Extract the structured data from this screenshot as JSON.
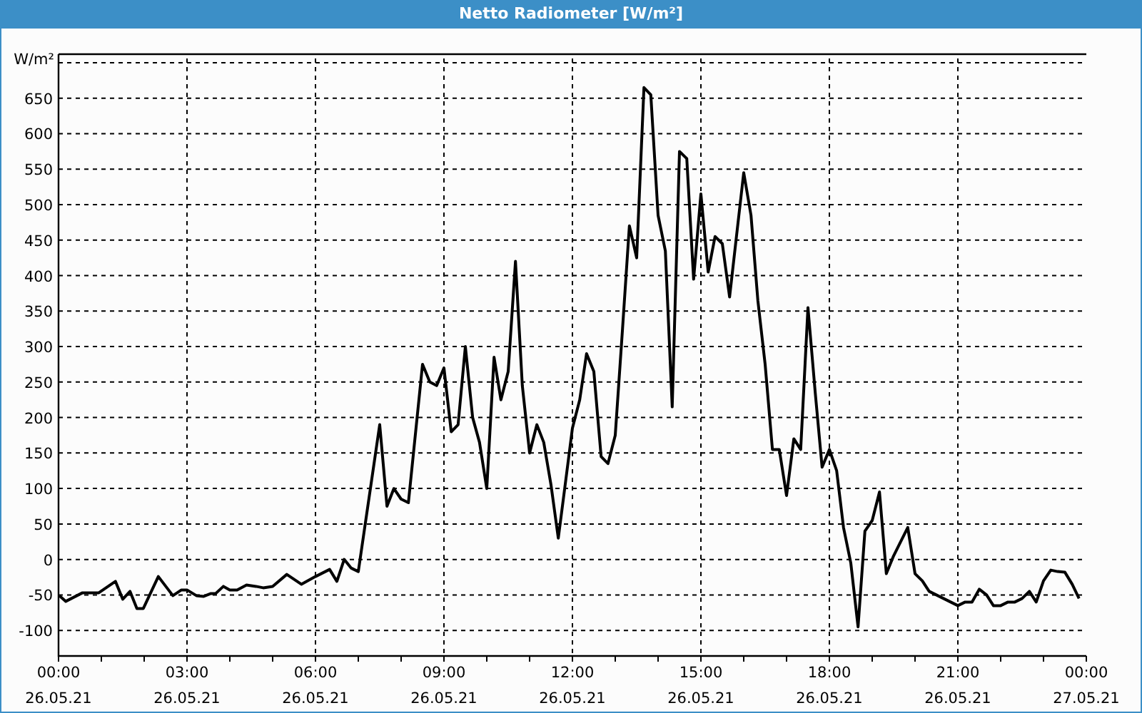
{
  "window": {
    "title": "Netto Radiometer [W/m²]"
  },
  "chart_data": {
    "type": "line",
    "ylabel": "W/m²",
    "xlim": [
      0,
      24
    ],
    "ylim": [
      -136,
      706
    ],
    "x": [
      0.02,
      0.17,
      0.56,
      0.94,
      1.28,
      1.33,
      1.5,
      1.67,
      1.83,
      1.98,
      2.33,
      2.67,
      2.87,
      3.0,
      3.22,
      3.39,
      3.56,
      3.67,
      3.85,
      4.0,
      4.17,
      4.39,
      4.61,
      4.78,
      5.0,
      5.33,
      5.67,
      6.0,
      6.33,
      6.5,
      6.67,
      6.83,
      7.0,
      7.5,
      7.67,
      7.83,
      8.0,
      8.17,
      8.5,
      8.67,
      8.83,
      9.0,
      9.17,
      9.33,
      9.5,
      9.67,
      9.83,
      10.0,
      10.17,
      10.33,
      10.5,
      10.67,
      10.83,
      11.0,
      11.17,
      11.33,
      11.5,
      11.67,
      11.83,
      12.0,
      12.17,
      12.33,
      12.5,
      12.67,
      12.83,
      13.0,
      13.17,
      13.33,
      13.5,
      13.67,
      13.83,
      14.0,
      14.17,
      14.33,
      14.5,
      14.67,
      14.83,
      15.0,
      15.17,
      15.33,
      15.5,
      15.67,
      15.83,
      16.0,
      16.17,
      16.33,
      16.5,
      16.67,
      16.83,
      17.0,
      17.17,
      17.33,
      17.5,
      17.67,
      17.83,
      18.0,
      18.17,
      18.33,
      18.5,
      18.67,
      18.83,
      19.0,
      19.17,
      19.33,
      19.5,
      19.83,
      20.0,
      20.17,
      20.33,
      21.0,
      21.17,
      21.33,
      21.5,
      21.67,
      21.83,
      22.0,
      22.17,
      22.33,
      22.5,
      22.67,
      22.83,
      23.0,
      23.17,
      23.33,
      23.5,
      23.67,
      23.83
    ],
    "series": [
      {
        "color": "#000000",
        "values": [
          -51,
          -59,
          -47,
          -47,
          -33,
          -31,
          -56,
          -45,
          -69,
          -69,
          -24,
          -51,
          -43,
          -43,
          -51,
          -52,
          -48,
          -48,
          -38,
          -43,
          -43,
          -36,
          -38,
          -40,
          -38,
          -21,
          -35,
          -24,
          -14,
          -31,
          0,
          -12,
          -17,
          190,
          75,
          100,
          85,
          80,
          275,
          250,
          245,
          270,
          180,
          190,
          300,
          200,
          165,
          100,
          285,
          225,
          265,
          420,
          245,
          150,
          190,
          165,
          105,
          30,
          105,
          185,
          225,
          290,
          265,
          145,
          135,
          175,
          325,
          470,
          425,
          665,
          655,
          485,
          435,
          215,
          575,
          565,
          395,
          515,
          405,
          455,
          445,
          370,
          455,
          545,
          485,
          365,
          275,
          155,
          155,
          90,
          170,
          155,
          355,
          235,
          130,
          155,
          125,
          45,
          -5,
          -95,
          40,
          55,
          95,
          -20,
          5,
          45,
          -20,
          -30,
          -45,
          -65,
          -60,
          -60,
          -42,
          -50,
          -65,
          -65,
          -60,
          -60,
          -55,
          -45,
          -60,
          -30,
          -15,
          -17,
          -18,
          -35,
          -55
        ]
      }
    ],
    "xticks": [
      {
        "value": 0,
        "label": "00:00"
      },
      {
        "value": 3,
        "label": "03:00"
      },
      {
        "value": 6,
        "label": "06:00"
      },
      {
        "value": 9,
        "label": "09:00"
      },
      {
        "value": 12,
        "label": "12:00"
      },
      {
        "value": 15,
        "label": "15:00"
      },
      {
        "value": 18,
        "label": "18:00"
      },
      {
        "value": 21,
        "label": "21:00"
      },
      {
        "value": 24,
        "label": "00:00"
      }
    ],
    "annotations": [
      "26.05.21",
      "26.05.21",
      "26.05.21",
      "26.05.21",
      "26.05.21",
      "26.05.21",
      "26.05.21",
      "26.05.21",
      "27.05.21"
    ],
    "grid": true,
    "yticks": [
      -100,
      -50,
      0,
      50,
      100,
      150,
      200,
      250,
      300,
      350,
      400,
      450,
      500,
      550,
      600,
      650
    ]
  }
}
